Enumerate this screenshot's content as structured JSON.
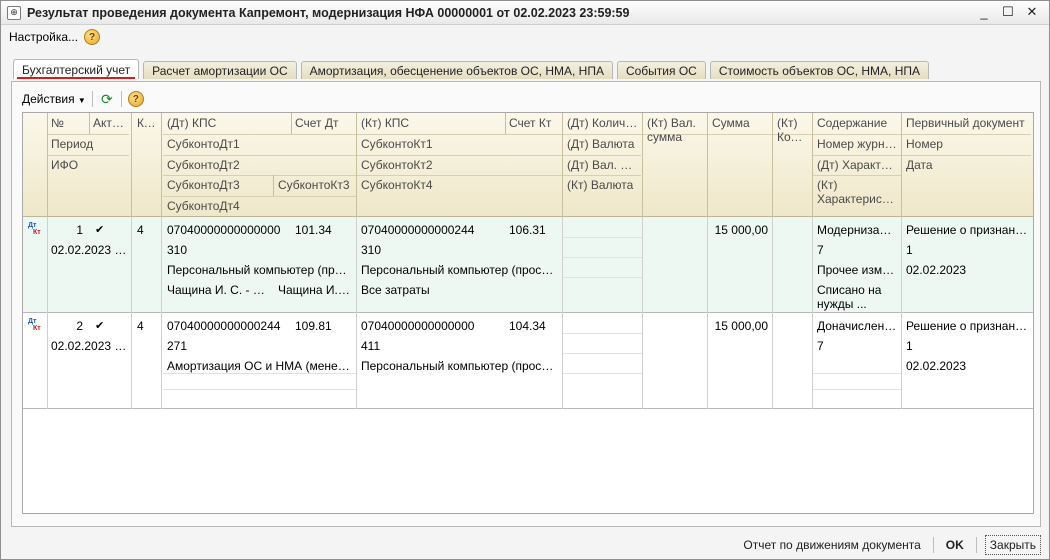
{
  "window": {
    "title": "Результат проведения документа Капремонт, модернизация НФА 00000001 от 02.02.2023 23:59:59",
    "minimize": "_",
    "maximize": "☐",
    "close": "✕"
  },
  "menu": {
    "settings": "Настройка...",
    "help": "?"
  },
  "tabs": [
    "Бухгалтерский учет",
    "Расчет амортизации ОС",
    "Амортизация, обесценение объектов ОС, НМА, НПА",
    "События ОС",
    "Стоимость объектов ОС, НМА, НПА"
  ],
  "toolbar": {
    "actions": "Действия",
    "help": "?"
  },
  "headers": {
    "num": "№",
    "active": "Акти...",
    "kfo": "КФО",
    "period": "Период",
    "ifo": "ИФО",
    "dt_kps": "(Дт) КПС",
    "schet_dt": "Счет Дт",
    "subkonto_dt1": "СубконтоДт1",
    "subkonto_dt2": "СубконтоДт2",
    "subkonto_dt3": "СубконтоДт3",
    "subkonto_kt3": "СубконтоКт3",
    "subkonto_dt4": "СубконтоДт4",
    "kt_kps": "(Кт) КПС",
    "schet_kt": "Счет Кт",
    "subkonto_kt1": "СубконтоКт1",
    "subkonto_kt2": "СубконтоКт2",
    "subkonto_kt4": "СубконтоКт4",
    "dt_qty": "(Дт) Количес...",
    "dt_currency": "(Дт) Валюта",
    "dt_cur_sum": "(Дт) Вал. су...",
    "kt_currency": "(Кт) Валюта",
    "kt_cur_sum": "(Кт) Вал. сумма",
    "sum": "Сумма",
    "kt_qty": "(Кт) Колич",
    "content": "Содержание",
    "journal_no": "Номер журнала",
    "dt_char": "(Дт) Характер...",
    "kt_char": "(Кт) Характеристик",
    "primary_doc": "Первичный документ",
    "number": "Номер",
    "date": "Дата"
  },
  "rows": [
    {
      "dt_label": "Дт",
      "kt_label": "Кт",
      "num": "1",
      "active": "✔",
      "kfo": "4",
      "period": "02.02.2023 23...",
      "dt_kps": "07040000000000000",
      "schet_dt": "101.34",
      "dt_line2": "310",
      "dt_line3": "Персональный компьютер (просле...",
      "dt_line4a": "Чащина И. С. - Отд...",
      "dt_line4b": "Чащина И. С...",
      "kt_kps": "07040000000000244",
      "schet_kt": "106.31",
      "kt_line2": "310",
      "kt_line3": "Персональный компьютер (прослеж...",
      "kt_line4": "Все затраты",
      "sum": "15 000,00",
      "content": "Модернизаци...",
      "journal": "7",
      "dt_char": "Прочее измен...",
      "kt_char": "Списано на нужды ...",
      "primary_doc": "Решение о признании ...",
      "doc_number": "1",
      "doc_date": "02.02.2023"
    },
    {
      "dt_label": "Дт",
      "kt_label": "Кт",
      "num": "2",
      "active": "✔",
      "kfo": "4",
      "period": "02.02.2023 23...",
      "dt_kps": "07040000000000244",
      "schet_dt": "109.81",
      "dt_line2": "271",
      "dt_line3": "Амортизация ОС и НМА (менее 10...",
      "kt_kps": "07040000000000000",
      "schet_kt": "104.34",
      "kt_line2": "411",
      "kt_line3": "Персональный компьютер (прослеж...",
      "sum": "15 000,00",
      "content": "Доначислено ...",
      "journal": "7",
      "primary_doc": "Решение о признании ...",
      "doc_number": "1",
      "doc_date": "02.02.2023"
    }
  ],
  "status": {
    "report": "Отчет по движениям документа",
    "ok": "OK",
    "close": "Закрыть"
  }
}
